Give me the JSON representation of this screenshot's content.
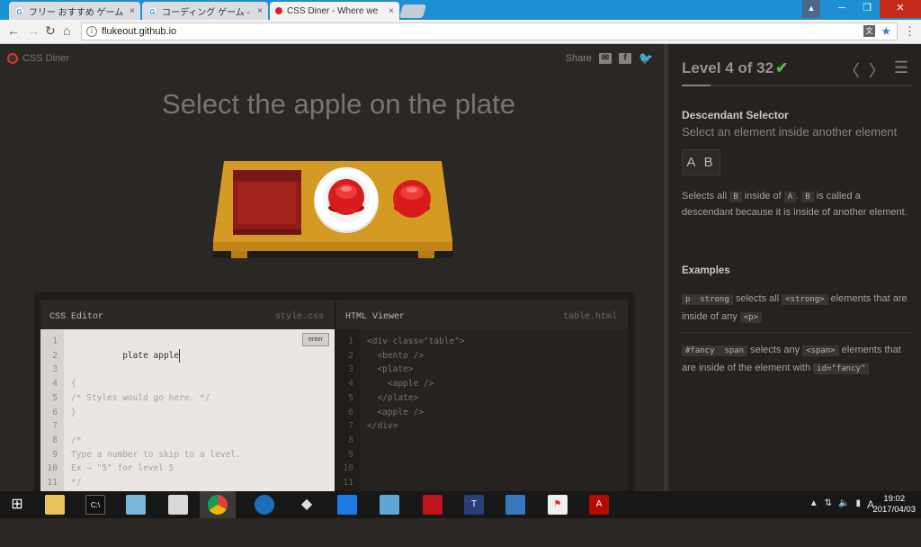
{
  "browser": {
    "tabs": [
      {
        "title": "フリー おすすめ ゲーム - Go",
        "favicon": "google-icon"
      },
      {
        "title": "コーディング ゲーム - Googl",
        "favicon": "google-icon"
      },
      {
        "title": "CSS Diner - Where we",
        "favicon": "css-diner-icon",
        "active": true
      }
    ],
    "url": "flukeout.github.io",
    "close_glyph": "×",
    "win_controls": {
      "minimize": "─",
      "restore": "❐",
      "close": "✕",
      "user": "▲"
    }
  },
  "game": {
    "logo_text": "CSS Diner",
    "share_label": "Share",
    "instruction": "Select the apple on the plate",
    "table_items": [
      "bento",
      "plate-with-apple",
      "apple"
    ],
    "colors": {
      "table": "#d59a23",
      "apple": "#d61c1c",
      "bento": "#a3231e",
      "plate": "#ffffff"
    }
  },
  "editor": {
    "css_header": "CSS Editor",
    "css_file": "style.css",
    "html_header": "HTML Viewer",
    "html_file": "table.html",
    "enter_label": "enter",
    "input_value": "plate apple",
    "css_lines": [
      "{",
      "/* Styles would go here. */",
      "}",
      "",
      "/*",
      "Type a number to skip to a level.",
      "Ex → \"5\" for level 5",
      "*/",
      "",
      ""
    ],
    "line_numbers": [
      "1",
      "2",
      "3",
      "4",
      "5",
      "6",
      "7",
      "8",
      "9",
      "10",
      "11"
    ],
    "html_lines": [
      "<div class=\"table\">",
      "  <bento />",
      "  <plate>",
      "    <apple />",
      "  </plate>",
      "  <apple />",
      "</div>",
      "",
      "",
      "",
      ""
    ]
  },
  "sidebar": {
    "level_text": "Level 4 of 32",
    "selector_name": "Descendant Selector",
    "selector_title": "Select an element inside another element",
    "syntax": "A B",
    "desc_1": "Selects all",
    "desc_code_b": "B",
    "desc_2": "inside of",
    "desc_code_a": "A",
    "desc_sep": ".",
    "desc_code_b2": "B",
    "desc_3": "is called a descendant because it is inside of another element.",
    "examples_heading": "Examples",
    "ex1_code": "p  strong",
    "ex1_text1": "selects all",
    "ex1_code2": "<strong>",
    "ex1_text2": "elements that are inside of any",
    "ex1_code3": "<p>",
    "ex2_code": "#fancy  span",
    "ex2_text1": "selects any",
    "ex2_code2": "<span>",
    "ex2_text2": "elements that are inside of the element with",
    "ex2_code3": "id=\"fancy\""
  },
  "taskbar": {
    "time": "19:02",
    "date": "2017/04/03",
    "ime": "A",
    "tray_up": "▲",
    "apps": [
      "windows-start-icon",
      "file-explorer-icon",
      "cmd-icon",
      "notepad-icon",
      "wordpad-icon",
      "chrome-icon",
      "app-blue-icon",
      "inkscape-icon",
      "dropbox-icon",
      "folder-icon",
      "filezilla-icon",
      "app-t-icon",
      "app-pen-icon",
      "app-flag-icon",
      "acrobat-icon"
    ]
  }
}
